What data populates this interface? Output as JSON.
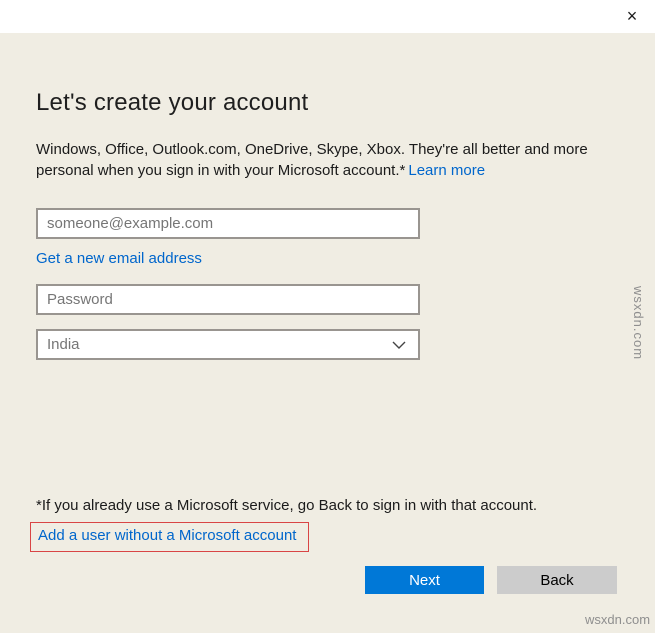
{
  "window": {
    "close_glyph": "×"
  },
  "page": {
    "title": "Let's create your account",
    "description": "Windows, Office, Outlook.com, OneDrive, Skype, Xbox. They're all better and more personal when you sign in with your Microsoft account.*",
    "learn_more": "Learn more"
  },
  "form": {
    "email_placeholder": "someone@example.com",
    "new_email_link": "Get a new email address",
    "password_placeholder": "Password",
    "country_value": "India"
  },
  "footer": {
    "note": "*If you already use a Microsoft service, go Back to sign in with that account.",
    "local_account_link": "Add a user without a Microsoft account",
    "next_label": "Next",
    "back_label": "Back"
  },
  "watermark": "wsxdn.com",
  "colors": {
    "background": "#f0ede3",
    "titlebar": "#ffffff",
    "accent_button": "#0078d7",
    "secondary_button": "#cccccc",
    "link": "#0066cc",
    "input_border": "#999590",
    "annotation_border": "#d94545",
    "placeholder_text": "#767676"
  }
}
